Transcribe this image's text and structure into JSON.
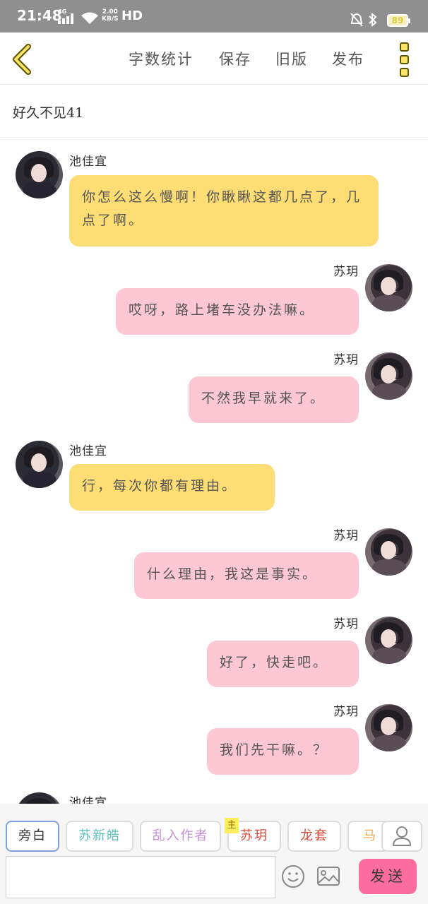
{
  "status_bar": {
    "time": "21:48",
    "signal_tag": "4G",
    "speed_value": "2.00",
    "speed_unit": "KB/S",
    "hd": "HD",
    "battery": "89"
  },
  "header": {
    "actions": [
      "字数统计",
      "保存",
      "旧版",
      "发布"
    ]
  },
  "story_title": "好久不见41",
  "messages": [
    {
      "side": "left",
      "sender": "池佳宜",
      "text": "你怎么这么慢啊！你瞅瞅这都几点了，几点了啊。",
      "bubble_color": "#fedd74"
    },
    {
      "side": "right",
      "sender": "苏玥",
      "text": "哎呀，路上堵车没办法嘛。",
      "bubble_color": "#fdc8d3"
    },
    {
      "side": "right",
      "sender": "苏玥",
      "text": "不然我早就来了。",
      "bubble_color": "#fdc8d3"
    },
    {
      "side": "left",
      "sender": "池佳宜",
      "text": "行，每次你都有理由。",
      "bubble_color": "#fedd74"
    },
    {
      "side": "right",
      "sender": "苏玥",
      "text": "什么理由，我这是事实。",
      "bubble_color": "#fdc8d3"
    },
    {
      "side": "right",
      "sender": "苏玥",
      "text": "好了，快走吧。",
      "bubble_color": "#fdc8d3"
    },
    {
      "side": "right",
      "sender": "苏玥",
      "text": "我们先干嘛。？",
      "bubble_color": "#fdc8d3"
    },
    {
      "side": "left",
      "sender": "池佳宜",
      "text": "",
      "bubble_color": "#fedd74"
    }
  ],
  "roles": [
    {
      "label": "旁白",
      "color": "#555555"
    },
    {
      "label": "苏新皓",
      "color": "#5bbfb9"
    },
    {
      "label": "乱入作者",
      "color": "#c58fd6"
    },
    {
      "label": "苏玥",
      "color": "#d94a3a",
      "badge": "主"
    },
    {
      "label": "龙套",
      "color": "#d94a3a"
    },
    {
      "label": "马嘉",
      "color": "#f0a85b"
    }
  ],
  "composer": {
    "placeholder": "",
    "send_label": "发送"
  },
  "colors": {
    "accent_yellow": "#fedd74",
    "accent_pink": "#fdc8d3",
    "send_button": "#fc6c9f"
  }
}
